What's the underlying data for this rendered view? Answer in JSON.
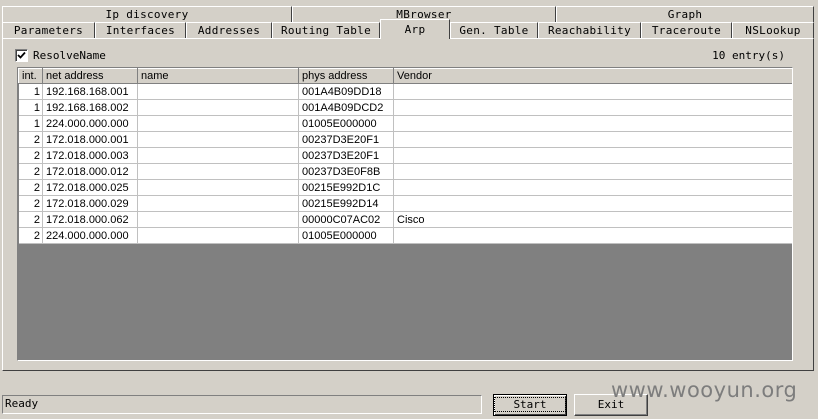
{
  "tabs_back": [
    "Ip discovery",
    "MBrowser",
    "Graph"
  ],
  "tabs_front": [
    "Parameters",
    "Interfaces",
    "Addresses",
    "Routing Table",
    "Arp",
    "Gen. Table",
    "Reachability",
    "Traceroute",
    "NSLookup"
  ],
  "active_tab": "Arp",
  "resolve": {
    "label": "ResolveName",
    "checked": true
  },
  "entries_count": "10 entry(s)",
  "columns": [
    "int.",
    "net address",
    "name",
    "phys address",
    "Vendor"
  ],
  "rows": [
    {
      "int": "1",
      "net": "192.168.168.001",
      "name": "",
      "phys": "001A4B09DD18",
      "vendor": ""
    },
    {
      "int": "1",
      "net": "192.168.168.002",
      "name": "",
      "phys": "001A4B09DCD2",
      "vendor": ""
    },
    {
      "int": "1",
      "net": "224.000.000.000",
      "name": "",
      "phys": "01005E000000",
      "vendor": ""
    },
    {
      "int": "2",
      "net": "172.018.000.001",
      "name": "",
      "phys": "00237D3E20F1",
      "vendor": ""
    },
    {
      "int": "2",
      "net": "172.018.000.003",
      "name": "",
      "phys": "00237D3E20F1",
      "vendor": ""
    },
    {
      "int": "2",
      "net": "172.018.000.012",
      "name": "",
      "phys": "00237D3E0F8B",
      "vendor": ""
    },
    {
      "int": "2",
      "net": "172.018.000.025",
      "name": "",
      "phys": "00215E992D1C",
      "vendor": ""
    },
    {
      "int": "2",
      "net": "172.018.000.029",
      "name": "",
      "phys": "00215E992D14",
      "vendor": ""
    },
    {
      "int": "2",
      "net": "172.018.000.062",
      "name": "",
      "phys": "00000C07AC02",
      "vendor": "Cisco"
    },
    {
      "int": "2",
      "net": "224.000.000.000",
      "name": "",
      "phys": "01005E000000",
      "vendor": ""
    }
  ],
  "status_text": "Ready",
  "buttons": {
    "start": "Start",
    "exit": "Exit"
  },
  "watermark": "www.wooyun.org"
}
